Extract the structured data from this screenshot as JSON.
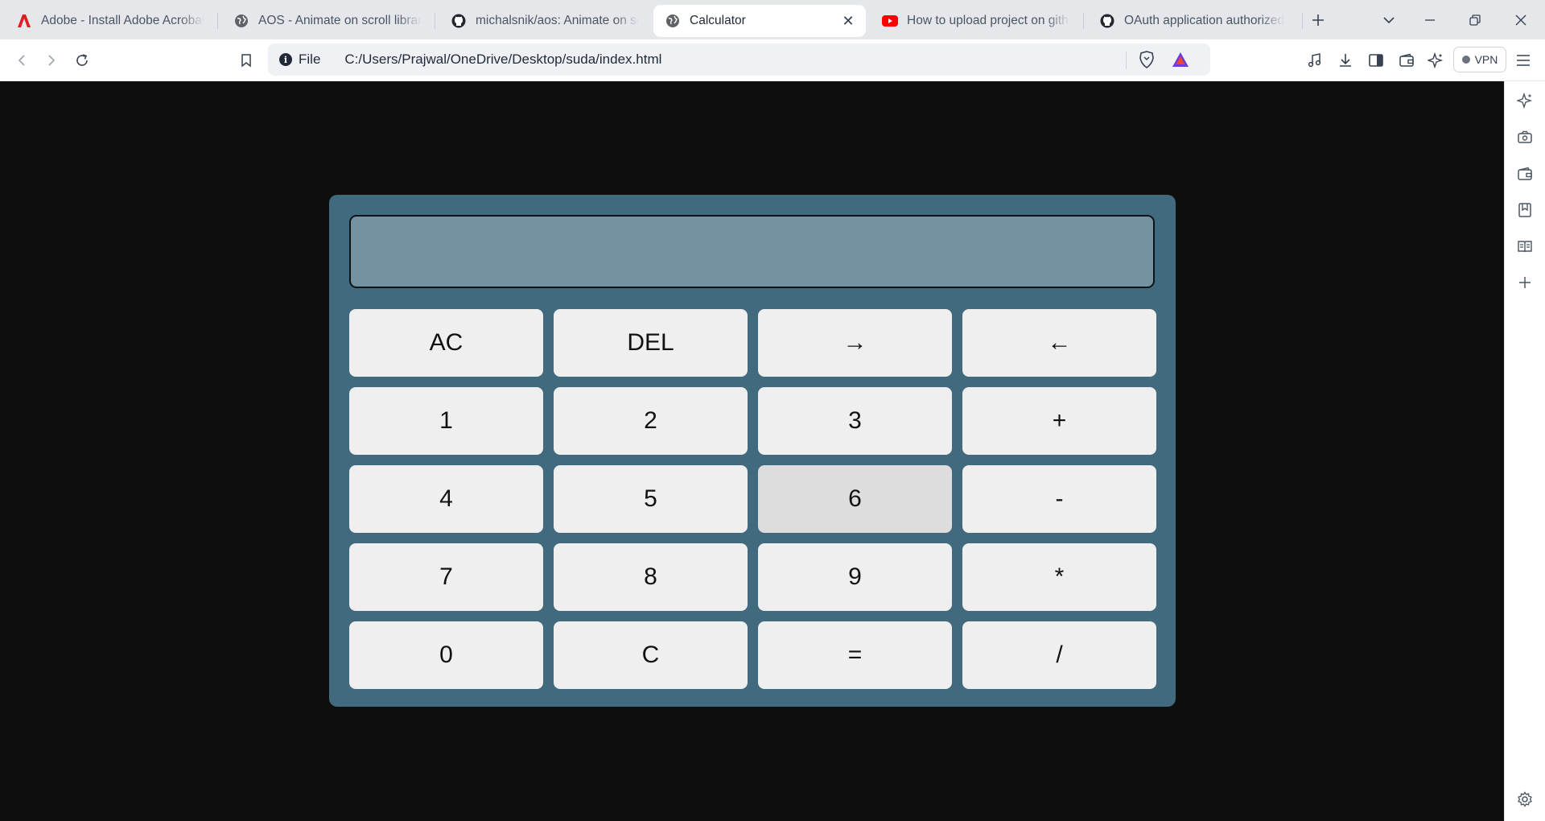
{
  "tabs": [
    {
      "title": "Adobe - Install Adobe Acrobat",
      "favicon": "adobe-icon",
      "active": false
    },
    {
      "title": "AOS - Animate on scroll library",
      "favicon": "globe-icon",
      "active": false
    },
    {
      "title": "michalsnik/aos: Animate on scroll",
      "favicon": "github-icon",
      "active": false
    },
    {
      "title": "Calculator",
      "favicon": "globe-icon",
      "active": true
    },
    {
      "title": "How to upload project on github",
      "favicon": "youtube-icon",
      "active": false
    },
    {
      "title": "OAuth application authorized",
      "favicon": "github-icon",
      "active": false
    }
  ],
  "address_bar": {
    "scheme_label": "File",
    "url": "C:/Users/Prajwal/OneDrive/Desktop/suda/index.html"
  },
  "toolbar": {
    "vpn_label": "VPN"
  },
  "calculator": {
    "display_value": "",
    "keys": [
      {
        "label": "AC",
        "name": "key-all-clear"
      },
      {
        "label": "DEL",
        "name": "key-delete"
      },
      {
        "label": "→",
        "name": "key-right-arrow"
      },
      {
        "label": "←",
        "name": "key-left-arrow"
      },
      {
        "label": "1",
        "name": "key-1"
      },
      {
        "label": "2",
        "name": "key-2"
      },
      {
        "label": "3",
        "name": "key-3"
      },
      {
        "label": "+",
        "name": "key-plus"
      },
      {
        "label": "4",
        "name": "key-4"
      },
      {
        "label": "5",
        "name": "key-5"
      },
      {
        "label": "6",
        "name": "key-6",
        "hover": true
      },
      {
        "label": "-",
        "name": "key-minus"
      },
      {
        "label": "7",
        "name": "key-7"
      },
      {
        "label": "8",
        "name": "key-8"
      },
      {
        "label": "9",
        "name": "key-9"
      },
      {
        "label": "*",
        "name": "key-multiply"
      },
      {
        "label": "0",
        "name": "key-0"
      },
      {
        "label": "C",
        "name": "key-clear"
      },
      {
        "label": "=",
        "name": "key-equals"
      },
      {
        "label": "/",
        "name": "key-divide"
      }
    ]
  },
  "colors": {
    "page_background": "#0f0e0f",
    "calculator_body": "#426a7e",
    "display_background": "#74929f",
    "key_background": "#efefef",
    "key_hover": "#dddddd"
  }
}
